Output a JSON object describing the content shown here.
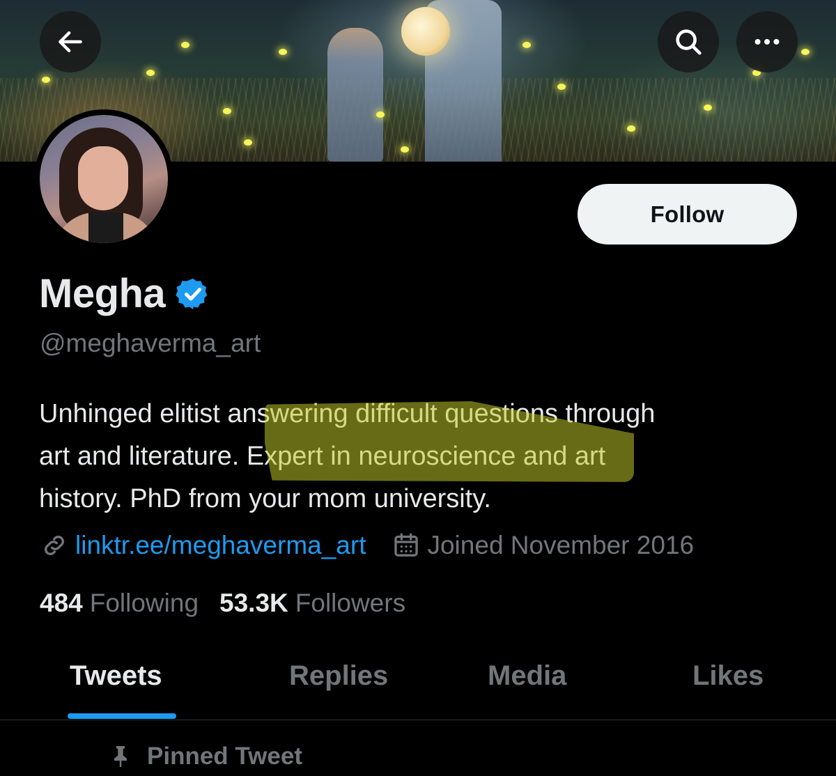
{
  "header": {
    "back_icon": "arrow-left-icon",
    "search_icon": "search-icon",
    "more_icon": "more-horizontal-icon"
  },
  "profile": {
    "name": "Megha",
    "verified_icon": "verified-badge-icon",
    "handle": "@meghaverma_art",
    "bio_line1": "Unhinged elitist answering difficult questions through",
    "bio_line2": "art and literature. Expert in neuroscience and art",
    "bio_line3": "history. PhD from your mom university.",
    "link_icon": "link-icon",
    "link": "linktr.ee/meghaverma_art",
    "calendar_icon": "calendar-icon",
    "joined": "Joined November 2016",
    "following_count": "484",
    "following_label": "Following",
    "followers_count": "53.3K",
    "followers_label": "Followers"
  },
  "actions": {
    "follow_label": "Follow"
  },
  "tabs": [
    {
      "label": "Tweets",
      "active": true
    },
    {
      "label": "Replies",
      "active": false
    },
    {
      "label": "Media",
      "active": false
    },
    {
      "label": "Likes",
      "active": false
    }
  ],
  "pinned": {
    "icon": "pin-icon",
    "label": "Pinned Tweet"
  },
  "colors": {
    "accent": "#1d9bf0",
    "highlight": "#c7cd28",
    "background": "#000000"
  }
}
